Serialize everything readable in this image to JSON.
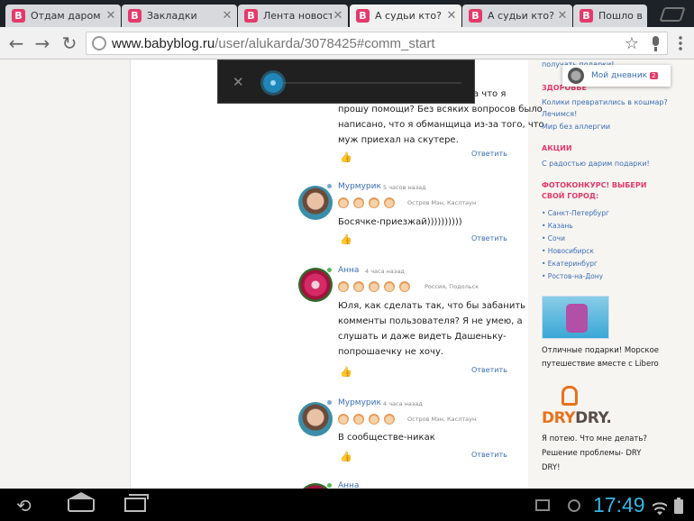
{
  "browser": {
    "tabs": [
      {
        "title": "Отдам даром",
        "favicon": "B",
        "active": false
      },
      {
        "title": "Закладки",
        "favicon": "B",
        "active": false
      },
      {
        "title": "Лента новостей",
        "favicon": "B",
        "active": false
      },
      {
        "title": "А судьи кто?",
        "favicon": "B",
        "active": true
      },
      {
        "title": "А судьи кто?",
        "favicon": "B",
        "active": false
      },
      {
        "title": "Пошло в",
        "favicon": "B",
        "active": false
      }
    ],
    "tab_close_glyph": "✕",
    "url_domain": "www.babyblog.ru",
    "url_path": "/user/alukarda/3078425#comm_start",
    "back_glyph": "←",
    "forward_glyph": "→",
    "reload_glyph": "↻",
    "star_glyph": "☆"
  },
  "comments": [
    {
      "text_lines": [
        "а что я",
        "прошу помощи? Без всяких вопросов было",
        "написано, что я обманщица из-за того, что",
        "муж приехал на скутере."
      ],
      "reply": "Ответить"
    },
    {
      "author": "Мурмурик",
      "time": "5 часов назад",
      "location": "Остров Мэн, Каслтаун",
      "text_lines": [
        "Босячке-приезжай))))))))))"
      ],
      "reply": "Ответить"
    },
    {
      "author": "Анна",
      "time": "4 часа назад",
      "location": "Россия, Подольск",
      "text_lines": [
        "Юля, как сделать так, что бы забанить",
        "комменты пользователя? Я не умею, а",
        "слушать и даже видеть Дашеньку-",
        "попрошаечку не хочу."
      ],
      "reply": "Ответить"
    },
    {
      "author": "Мурмурик",
      "time": "4 часа назад",
      "location": "Остров Мэн, Каслтаун",
      "text_lines": [
        "В сообществе-никак"
      ],
      "reply": "Ответить"
    },
    {
      "author": "Анна"
    }
  ],
  "sidebar": {
    "my_diary": "Мой дневник",
    "my_diary_badge": "2",
    "top_link": "получать подарки!",
    "health_head": "ЗДОРОВЬЕ",
    "health_links": [
      "Колики превратились в кошмар?",
      "Лечимся!",
      "Мир без аллергии"
    ],
    "promo_head": "АКЦИИ",
    "promo_link": "С радостью дарим подарки!",
    "photo_head_lines": [
      "ФОТОКОНКУРС! ВЫБЕРИ",
      "СВОЙ ГОРОД:"
    ],
    "cities": [
      "• Санкт-Петербург",
      "• Казань",
      "• Сочи",
      "• Новосибирск",
      "• Екатеринбург",
      "• Ростов-на-Дону"
    ],
    "libero_text_lines": [
      "Отличные подарки! Морское",
      "путешествие вместе с Libero"
    ],
    "drydry_logo_a": "DRY",
    "drydry_logo_b": "DRY.",
    "drydry_text_lines": [
      "Я потею. Что мне делать?",
      "Решение проблемы- DRY",
      "DRY!"
    ]
  },
  "system": {
    "clock": "17:49",
    "back_glyph": "⟲",
    "accent": "#33b5e5"
  },
  "colors": {
    "brand_pink": "#e6396b",
    "link_blue": "#3a6fb6",
    "online_green": "#5cb85c",
    "online_blue": "#7aa7d8"
  }
}
